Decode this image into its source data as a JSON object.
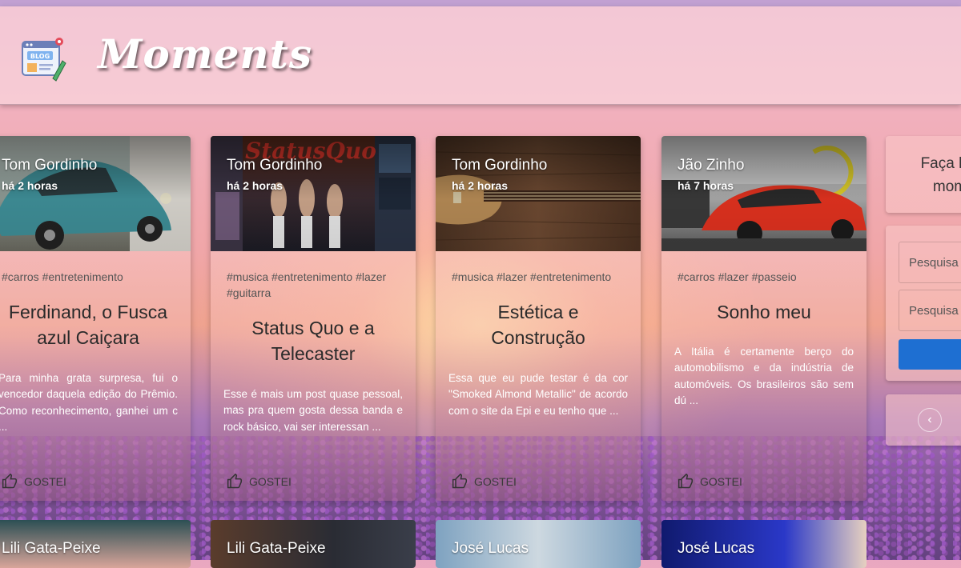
{
  "brand": {
    "name": "Moments",
    "logo_text": "BLOG"
  },
  "posts": [
    {
      "author": "Tom Gordinho",
      "time": "há 2 horas",
      "tags": "#carros #entretenimento",
      "title": "Ferdinand, o Fusca azul Caiçara",
      "excerpt": "Para minha grata surpresa, fui o vencedor daquela edição do Prêmio. Como reconhecimento, ganhei um c ...",
      "like_label": "GOSTEI",
      "image_icon": "blue-beetle-car-photo"
    },
    {
      "author": "Tom Gordinho",
      "time": "há 2 horas",
      "tags": "#musica #entretenimento #lazer #guitarra",
      "title": "Status Quo e a Telecaster",
      "excerpt": "Esse é mais um post quase pessoal, mas pra quem gosta dessa banda e rock básico, vai ser interessan ...",
      "like_label": "GOSTEI",
      "image_icon": "status-quo-album-collage",
      "image_caption": "StatusQuo"
    },
    {
      "author": "Tom Gordinho",
      "time": "há 2 horas",
      "tags": "#musica #lazer #entretenimento",
      "title": "Estética e Construção",
      "excerpt": "Essa que eu pude testar é da cor \"Smoked Almond Metallic\" de acordo com o site da Epi e eu tenho que ...",
      "like_label": "GOSTEI",
      "image_icon": "guitar-on-wood-photo"
    },
    {
      "author": "Jão Zinho",
      "time": "há 7 horas",
      "tags": "#carros #lazer #passeio",
      "title": "Sonho meu",
      "excerpt": "A Itália é certamente berço do automobilismo e da indústria de automóveis. Os brasileiros são sem dú ...",
      "like_label": "GOSTEI",
      "image_icon": "red-ferrari-photo"
    }
  ],
  "next_row": [
    {
      "author": "Lili Gata-Peixe"
    },
    {
      "author": "Lili Gata-Peixe"
    },
    {
      "author": "José Lucas"
    },
    {
      "author": "José Lucas"
    }
  ],
  "sidebar": {
    "login_line1": "Faça log",
    "login_line2": "mom",
    "search_placeholder_1": "Pesquisa",
    "search_placeholder_2": "Pesquisa",
    "prev_glyph": "‹"
  },
  "colors": {
    "accent": "#1e6fd2",
    "brand_text": "#ffffff"
  }
}
